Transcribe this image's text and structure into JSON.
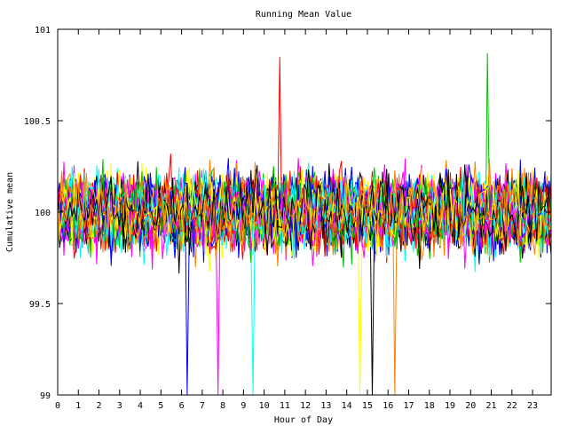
{
  "chart_data": {
    "type": "line",
    "title": "Running Mean Value",
    "xlabel": "Hour of Day",
    "ylabel": "Cumulative mean",
    "xlim": [
      0,
      23.9
    ],
    "ylim": [
      99,
      101
    ],
    "xticks": [
      0,
      1,
      2,
      3,
      4,
      5,
      6,
      7,
      8,
      9,
      10,
      11,
      12,
      13,
      14,
      15,
      16,
      17,
      18,
      19,
      20,
      21,
      22,
      23
    ],
    "xtick_labels": [
      "0",
      "1",
      "2",
      "3",
      "4",
      "5",
      "6",
      "7",
      "8",
      "9",
      "10",
      "11",
      "12",
      "13",
      "14",
      "15",
      "16",
      "17",
      "18",
      "19",
      "20",
      "21",
      "22",
      "23"
    ],
    "yticks": [
      99,
      99.5,
      100,
      100.5,
      101
    ],
    "ytick_labels": [
      "99",
      "99.5",
      "100",
      "100.5",
      "101"
    ],
    "grid": false,
    "legend": "none",
    "series_count": 48,
    "series_colors": [
      "#ff0000",
      "#00c000",
      "#0000ff",
      "#ff00ff",
      "#00ffff",
      "#ffff00",
      "#000000",
      "#ff8000"
    ],
    "series_center": 100,
    "series_spread": 0.22,
    "notable_points": [
      {
        "x": 10.8,
        "y": 100.85
      },
      {
        "x": 20.8,
        "y": 100.87
      },
      {
        "x": 6.3,
        "y": 99.0
      },
      {
        "x": 7.8,
        "y": 99.0
      },
      {
        "x": 9.5,
        "y": 99.0
      },
      {
        "x": 14.6,
        "y": 99.0
      },
      {
        "x": 15.2,
        "y": 99.0
      },
      {
        "x": 16.3,
        "y": 99.0
      }
    ]
  }
}
